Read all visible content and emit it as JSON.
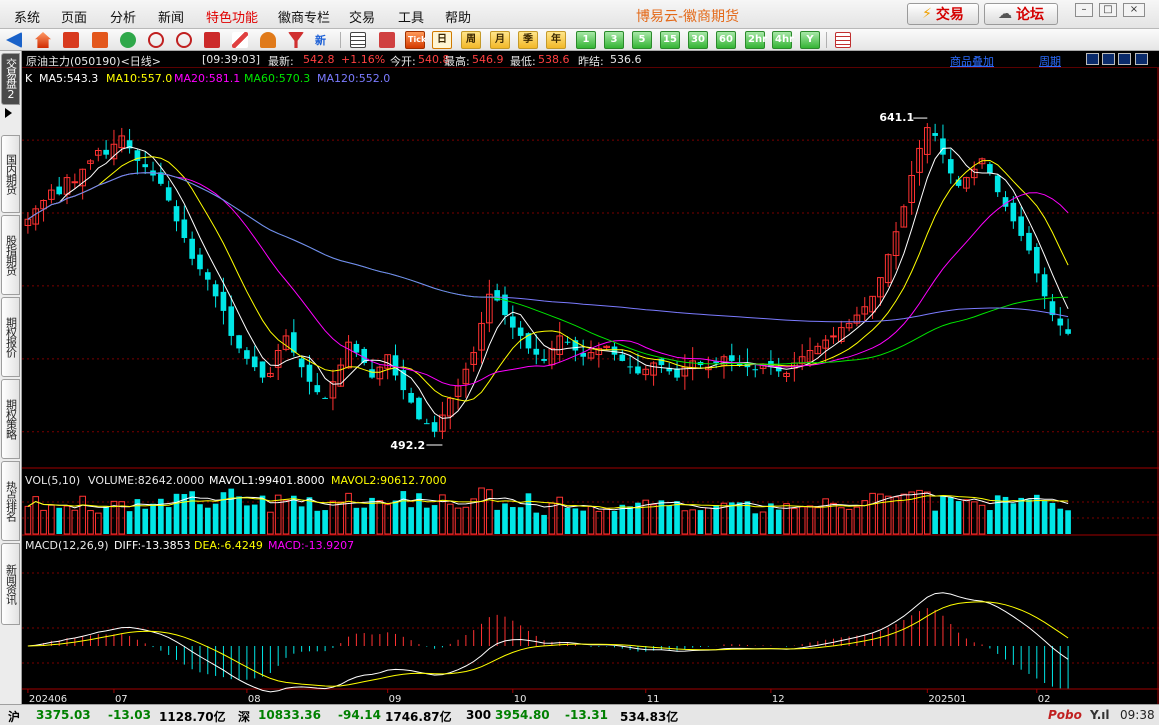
{
  "menu": {
    "items": [
      "系统",
      "页面",
      "分析",
      "新闻",
      "特色功能",
      "徽商专栏",
      "交易",
      "工具",
      "帮助"
    ],
    "special_index": 4,
    "app_title": "博易云-徽商期货",
    "trade_button": "交易",
    "forum_button": "论坛"
  },
  "toolbar": {
    "periods": [
      "日",
      "周",
      "月",
      "季",
      "年",
      "1",
      "3",
      "5",
      "15",
      "30",
      "60",
      "2hr",
      "4hr",
      "Y"
    ],
    "active_period": "日",
    "tick_label": "Tick",
    "new_label": "新"
  },
  "sidebar": {
    "tabs": [
      "交易盘2",
      "国内期货",
      "股指期货",
      "期权报价",
      "期权策略",
      "热点排名",
      "新闻资讯"
    ]
  },
  "info": {
    "contract": "原油主力(050190)<日线>",
    "time": "[09:39:03]",
    "latest_label": "最新:",
    "latest": "542.8",
    "change": "+1.16%",
    "open_label": "今开:",
    "open": "540.8",
    "high_label": "最高:",
    "high": "546.9",
    "low_label": "最低:",
    "low": "538.6",
    "prev_close_label": "昨结:",
    "prev_close": "536.6",
    "overlay_link": "商品叠加",
    "period_link": "周期"
  },
  "ma_legend": {
    "k": "K",
    "ma5": "MA5:543.3",
    "ma10": "MA10:557.0",
    "ma20": "MA20:581.1",
    "ma60": "MA60:570.3",
    "ma120": "MA120:552.0"
  },
  "vol_legend": {
    "name": "VOL(5,10)",
    "volume": "VOLUME:82642.0000",
    "mavol1": "MAVOL1:99401.8000",
    "mavol2": "MAVOL2:90612.7000"
  },
  "macd_legend": {
    "name": "MACD(12,26,9)",
    "diff": "DIFF:-13.3853",
    "dea": "DEA:-6.4249",
    "macd": "MACD:-13.9207"
  },
  "colors": {
    "up": "#ff3232",
    "down": "#00e6e6",
    "ma5": "#ffffff",
    "ma10": "#ffff00",
    "ma20": "#ff00ff",
    "ma60": "#00e600",
    "ma120": "#7b7bff"
  },
  "chart_data": {
    "type": "candlestick",
    "x_labels": [
      "202406",
      "07",
      "08",
      "09",
      "10",
      "11",
      "12",
      "202501",
      "02"
    ],
    "high_marker": "641.1",
    "low_marker": "492.2",
    "ylim": [
      480,
      660
    ],
    "closes": [
      597,
      602,
      606,
      611,
      609,
      617,
      615,
      621,
      625,
      630,
      628,
      633,
      637,
      631,
      625,
      622,
      618,
      614,
      606,
      596,
      588,
      578,
      573,
      568,
      560,
      553,
      541,
      535,
      530,
      526,
      521,
      523,
      534,
      541,
      533,
      526,
      519,
      514,
      511,
      519,
      527,
      538,
      533,
      528,
      521,
      526,
      532,
      522,
      515,
      509,
      501,
      499,
      495,
      503,
      511,
      517,
      525,
      533,
      547,
      561,
      558,
      551,
      545,
      541,
      535,
      532,
      529,
      535,
      541,
      538,
      534,
      531,
      533,
      535,
      536,
      532,
      529,
      526,
      523,
      525,
      528,
      527,
      524,
      521,
      526,
      529,
      527,
      526,
      528,
      531,
      529,
      527,
      526,
      525,
      527,
      526,
      524,
      523,
      528,
      531,
      534,
      536,
      539,
      541,
      545,
      547,
      551,
      555,
      560,
      569,
      580,
      591,
      603,
      618,
      631,
      641,
      637,
      628,
      619,
      613,
      617,
      621,
      626,
      619,
      610,
      603,
      596,
      589,
      582,
      571,
      560,
      551,
      546,
      542
    ],
    "volume_note": "volume and MACD are derived indicators drawn from the price series",
    "macd_ylim": [
      -30,
      30
    ]
  },
  "status": {
    "sh_label": "沪",
    "sh_index": "3375.03",
    "sh_change": "-13.03",
    "sh_amount": "1128.70亿",
    "sz_label": "深",
    "sz_index": "10833.36",
    "sz_change": "-94.14",
    "sz_amount": "1746.87亿",
    "c300_label": "300",
    "c300_index": "3954.80",
    "c300_change": "-13.31",
    "c300_amount": "534.83亿",
    "brand": "Pobo",
    "signal": "Y.ıl",
    "clock": "09:38"
  }
}
